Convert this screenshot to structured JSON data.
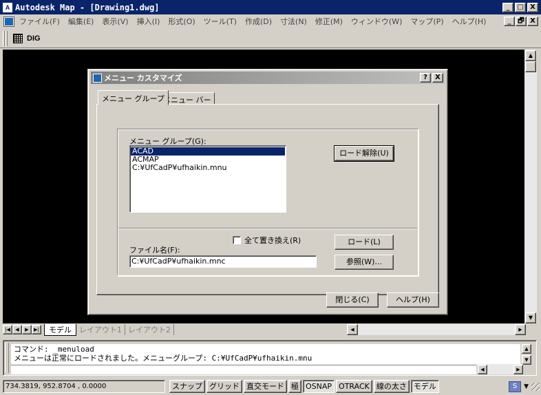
{
  "window": {
    "title": "Autodesk Map - [Drawing1.dwg]",
    "app_icon": "autodesk-map-icon",
    "controls": [
      "_",
      "□",
      "X"
    ],
    "doc_controls": [
      "_",
      "🗗",
      "X"
    ]
  },
  "menubar": {
    "items": [
      "ファイル(F)",
      "編集(E)",
      "表示(V)",
      "挿入(I)",
      "形式(O)",
      "ツール(T)",
      "作成(D)",
      "寸法(N)",
      "修正(M)",
      "ウィンドウ(W)",
      "マップ(P)",
      "ヘルプ(H)"
    ]
  },
  "toolbar": {
    "items": [
      "grid-icon",
      "DIG"
    ]
  },
  "layout_tabs": {
    "tabs": [
      "モデル",
      "レイアウト1",
      "レイアウト2"
    ]
  },
  "command": {
    "lines": [
      "コマンド: _menuload",
      "メニューは正常にロードされました。メニューグループ: C:¥UfCadP¥ufhaikin.mnu"
    ]
  },
  "status": {
    "coords": "734.3819,  952.8704 , 0.0000",
    "buttons": [
      "スナップ",
      "グリッド",
      "直交モード",
      "極",
      "OSNAP",
      "OTRACK",
      "線の太さ",
      "モデル"
    ]
  },
  "dialog": {
    "title": "メニュー カスタマイズ",
    "title_buttons": [
      "?",
      "X"
    ],
    "tabs": [
      "メニュー グループ",
      "メニュー バー"
    ],
    "group_label": "メニュー グループ(G):",
    "group_list": [
      "ACAD",
      "ACMAP",
      "C:¥UfCadP¥ufhaikin.mnu"
    ],
    "unload_button": "ロード解除(U)",
    "replace_all_label": "全て置き換え(R)",
    "replace_all_checked": false,
    "file_label": "ファイル名(F):",
    "file_value": "C:¥UfCadP¥ufhaikin.mnc",
    "load_button": "ロード(L)",
    "browse_button": "参照(W)...",
    "close_button": "閉じる(C)",
    "help_button": "ヘルプ(H)"
  }
}
